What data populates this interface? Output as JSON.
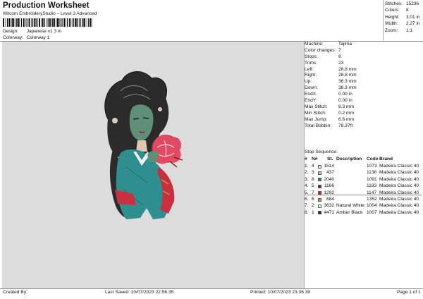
{
  "header": {
    "title": "Production Worksheet",
    "subtitle": "Wilcom EmbroideryStudio – Level 3 Advanced",
    "design_label": "Design:",
    "design_value": "Japanese v1 3 in",
    "colorway_label": "Colorway:",
    "colorway_value": "Colorway 1"
  },
  "summary": [
    {
      "label": "Stitches:",
      "value": "15236"
    },
    {
      "label": "Colors:",
      "value": "8"
    },
    {
      "label": "Height:",
      "value": "3.01 in"
    },
    {
      "label": "Width:",
      "value": "2.27 in"
    },
    {
      "label": "Zoom:",
      "value": "1:1"
    }
  ],
  "stats": [
    {
      "label": "Machine:",
      "value": "Tajima"
    },
    {
      "label": "Color changes:",
      "value": "7"
    },
    {
      "label": "Stops:",
      "value": "8"
    },
    {
      "label": "Trims:",
      "value": "23"
    },
    {
      "label": "Left:",
      "value": "28.8 mm"
    },
    {
      "label": "Right:",
      "value": "28.8 mm"
    },
    {
      "label": "Up:",
      "value": "38.3 mm"
    },
    {
      "label": "Down:",
      "value": "38.3 mm"
    },
    {
      "label": "EndX:",
      "value": "0.00 in"
    },
    {
      "label": "EndY:",
      "value": "0.00 in"
    },
    {
      "label": "Max Stitch:",
      "value": "8.3 mm"
    },
    {
      "label": "Min Stitch:",
      "value": "0.2 mm"
    },
    {
      "label": "Max Jump:",
      "value": "6.6 mm"
    },
    {
      "label": "Total Bobbin:",
      "value": "78.37ft"
    }
  ],
  "sequence": {
    "label": "Stop Sequence:",
    "headers": {
      "stop": "#",
      "n": "N#",
      "st": "St.",
      "desc": "Description",
      "code": "Code",
      "brand": "Brand"
    },
    "rows": [
      {
        "stop": "1.",
        "n": "4",
        "color": "#e8e2d6",
        "st": "1514",
        "desc": "",
        "code": "1073",
        "brand": "Madeira Classic 40"
      },
      {
        "stop": "2.",
        "n": "3",
        "color": "#e2c2a4",
        "st": "437",
        "desc": "",
        "code": "1138",
        "brand": "Madeira Classic 40"
      },
      {
        "stop": "3.",
        "n": "8",
        "color": "#2a8a8e",
        "st": "2040",
        "desc": "",
        "code": "1091",
        "brand": "Madeira Classic 40"
      },
      {
        "stop": "4.",
        "n": "5",
        "color": "#8a1020",
        "st": "1166",
        "desc": "",
        "code": "1183",
        "brand": "Madeira Classic 40"
      },
      {
        "stop": "5.",
        "n": "7",
        "color": "#c41e3a",
        "st": "1292",
        "desc": "",
        "code": "1147",
        "brand": "Madeira Classic 40"
      },
      {
        "stop": "6.",
        "n": "6",
        "color": "#c49a2e",
        "st": "684",
        "desc": "",
        "code": "1352",
        "brand": "Madeira Classic 40"
      },
      {
        "stop": "7.",
        "n": "2",
        "color": "#f2f2ee",
        "st": "3632",
        "desc": "Natural White",
        "code": "1004",
        "brand": "Madeira Classic 40"
      },
      {
        "stop": "8.",
        "n": "1",
        "color": "#2a2a2a",
        "st": "4471",
        "desc": "Amber Black",
        "code": "1007",
        "brand": "Madeira Classic 40"
      }
    ]
  },
  "footer": {
    "created_by": "Created By:",
    "last_saved": "Last Saved: 10/07/2023 22.56.35",
    "printed": "Printed: 10/07/2023 23.36.39",
    "page": "Page 1 of 1"
  }
}
